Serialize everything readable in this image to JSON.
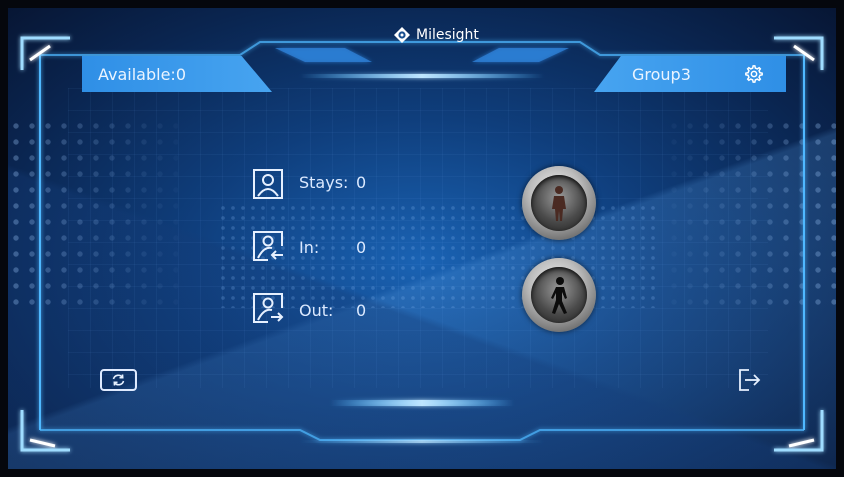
{
  "header": {
    "brand": "Milesight",
    "available_label": "Available:0",
    "group_name": "Group3"
  },
  "stats": [
    {
      "label": "Stays:",
      "value": "0",
      "icon": "person-icon"
    },
    {
      "label": "In:",
      "value": "0",
      "icon": "person-in-icon"
    },
    {
      "label": "Out:",
      "value": "0",
      "icon": "person-out-icon"
    }
  ],
  "icons": {
    "settings": "gear-icon",
    "refresh": "refresh-icon",
    "exit": "exit-icon",
    "signal_stop": "pedestrian-stop-icon",
    "signal_walk": "pedestrian-walk-icon"
  },
  "colors": {
    "accent": "#3a97ea",
    "background": "#0f3e7c",
    "frame_glow": "#4fb8ff",
    "text": "#dbe9ff"
  }
}
